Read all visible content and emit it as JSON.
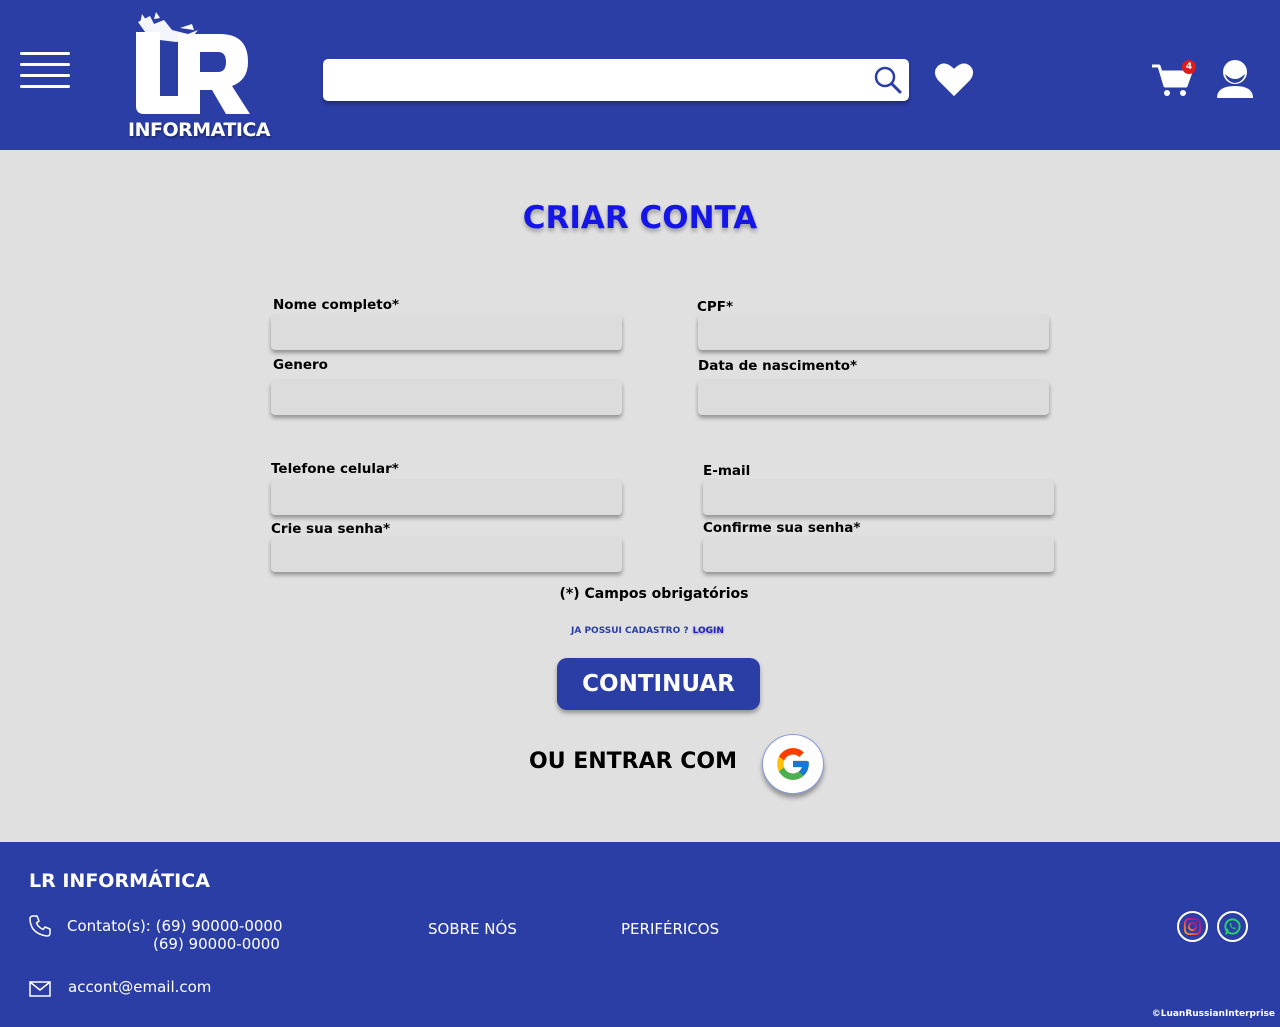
{
  "header": {
    "logo_text": "INFORMATICA",
    "search_placeholder": "",
    "cart_count": "4"
  },
  "main": {
    "title": "CRIAR CONTA",
    "fields": {
      "nome": "Nome completo*",
      "cpf": "CPF*",
      "genero": "Genero",
      "nascimento": "Data de nascimento*",
      "telefone": "Telefone celular*",
      "email": "E-mail",
      "senha": "Crie sua senha*",
      "confirma": "Confirme sua senha*"
    },
    "required_note": "(*) Campos obrigatórios",
    "login_prompt": "JA POSSUI CADASTRO ?",
    "login_link": "LOGIN",
    "continue_label": "CONTINUAR",
    "or_text": "OU ENTRAR COM"
  },
  "footer": {
    "brand": "LR INFORMÁTICA",
    "contact_label": "Contato(s): (69) 90000-0000",
    "contact_phone2": "(69) 90000-0000",
    "email": "accont@email.com",
    "link_about": "SOBRE NÓS",
    "link_peripherals": "PERIFÉRICOS",
    "copyright": "©LuanRussianInterprise"
  },
  "icons": [
    "menu-icon",
    "search-icon",
    "heart-icon",
    "cart-icon",
    "user-icon",
    "google-icon",
    "phone-icon",
    "mail-icon",
    "instagram-icon",
    "whatsapp-icon"
  ],
  "colors": {
    "brand_blue": "#2b3ea6",
    "title_blue": "#1515e8",
    "background": "#e0e0e0",
    "input_bg": "#dcdcdc",
    "badge_red": "#e01b1b"
  }
}
